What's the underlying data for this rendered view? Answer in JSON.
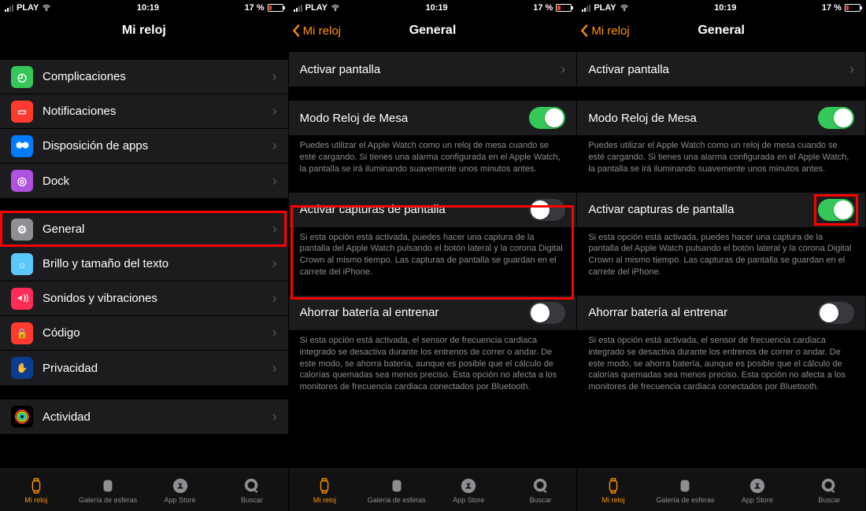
{
  "status": {
    "carrier": "PLAY",
    "time": "10:19",
    "battery": "17 %"
  },
  "nav": {
    "title_main": "Mi reloj",
    "title_general": "General",
    "back_label": "Mi reloj"
  },
  "s1_g1": [
    {
      "key": "complicaciones",
      "label": "Complicaciones",
      "icon": "green",
      "glyph": "◷"
    },
    {
      "key": "notificaciones",
      "label": "Notificaciones",
      "icon": "red",
      "glyph": "▭"
    },
    {
      "key": "disposicion",
      "label": "Disposición de apps",
      "icon": "blue",
      "glyph": "⋮⋮"
    },
    {
      "key": "dock",
      "label": "Dock",
      "icon": "purple",
      "glyph": "◎"
    }
  ],
  "s1_g2": [
    {
      "key": "general",
      "label": "General",
      "icon": "gray",
      "glyph": "⚙"
    },
    {
      "key": "brillo",
      "label": "Brillo y tamaño del texto",
      "icon": "lblue",
      "glyph": "☼"
    },
    {
      "key": "sonidos",
      "label": "Sonidos y vibraciones",
      "icon": "pink",
      "glyph": "◄))"
    },
    {
      "key": "codigo",
      "label": "Código",
      "icon": "red",
      "glyph": "🔒"
    },
    {
      "key": "privacidad",
      "label": "Privacidad",
      "icon": "dblue",
      "glyph": "✋"
    }
  ],
  "s1_g3": [
    {
      "key": "actividad",
      "label": "Actividad",
      "icon": "ring",
      "glyph": "◯"
    }
  ],
  "general": {
    "activar_pantalla": "Activar pantalla",
    "modo_mesa": "Modo Reloj de Mesa",
    "modo_mesa_note": "Puedes utilizar el Apple Watch como un reloj de mesa cuando se esté cargando. Si tienes una alarma configurada en el Apple Watch, la pantalla se irá iluminando suavemente unos minutos antes.",
    "capturas": "Activar capturas de pantalla",
    "capturas_note": "Si esta opción está activada, puedes hacer una captura de la pantalla del Apple Watch pulsando el botón lateral y la corona Digital Crown al mismo tiempo. Las capturas de pantalla se guardan en el carrete del iPhone.",
    "bateria": "Ahorrar batería al entrenar",
    "bateria_note": "Si esta opción está activada, el sensor de frecuencia cardiaca integrado se desactiva durante los entrenos de correr o andar. De este modo, se ahorra batería, aunque es posible que el cálculo de calorías quemadas sea menos preciso. Esta opción no afecta a los monitores de frecuencia cardiaca conectados por Bluetooth."
  },
  "tabs": {
    "mireloj": "Mi reloj",
    "galeria": "Galería de esferas",
    "appstore": "App Store",
    "buscar": "Buscar"
  }
}
